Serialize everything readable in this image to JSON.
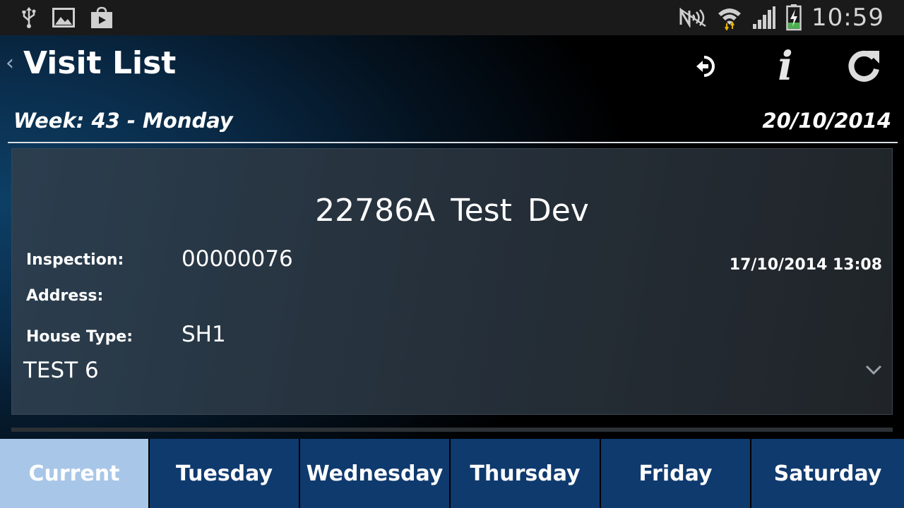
{
  "status_bar": {
    "time": "10:59",
    "icons_left": [
      "usb-icon",
      "image-icon",
      "shopping-bag-icon"
    ],
    "icons_right": [
      "nfc-off-icon",
      "wifi-icon",
      "signal-icon",
      "battery-charging-icon"
    ]
  },
  "action_bar": {
    "title": "Visit List",
    "back": "‹",
    "actions": [
      "logout-icon",
      "info-icon",
      "refresh-icon"
    ],
    "info_glyph": "i"
  },
  "header": {
    "week": "Week: 43 - Monday",
    "date": "20/10/2014"
  },
  "visit": {
    "title": "22786A  Test Dev",
    "inspection_label": "Inspection:",
    "inspection_value": "00000076",
    "datetime": "17/10/2014 13:08",
    "address_label": "Address:",
    "house_type_label": "House Type:",
    "house_type_value": "SH1",
    "note": "TEST 6"
  },
  "tabs": [
    {
      "label": "Current",
      "active": true
    },
    {
      "label": "Tuesday",
      "active": false
    },
    {
      "label": "Wednesday",
      "active": false
    },
    {
      "label": "Thursday",
      "active": false
    },
    {
      "label": "Friday",
      "active": false
    },
    {
      "label": "Saturday",
      "active": false
    }
  ],
  "colors": {
    "tab_active": "#a8c6e8",
    "tab_inactive": "#0f3a6e",
    "status_bar": "#1a1a1a"
  }
}
